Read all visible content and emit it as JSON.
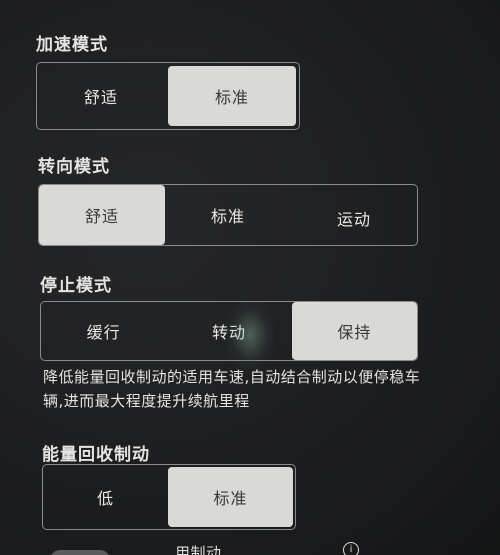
{
  "acceleration": {
    "title": "加速模式",
    "options": [
      "舒适",
      "标准"
    ],
    "selected": 1
  },
  "steering": {
    "title": "转向模式",
    "options": [
      "舒适",
      "标准",
      "运动"
    ],
    "selected": 0
  },
  "stop": {
    "title": "停止模式",
    "options": [
      "缓行",
      "转动",
      "保持"
    ],
    "selected": 2,
    "description": "降低能量回收制动的适用车速,自动结合制动以便停稳车辆,进而最大程度提升续航里程"
  },
  "regen": {
    "title": "能量回收制动",
    "options": [
      "低",
      "标准"
    ],
    "selected": 1
  },
  "bottom": {
    "text": "用制动"
  },
  "icons": {
    "info": "info-icon"
  }
}
